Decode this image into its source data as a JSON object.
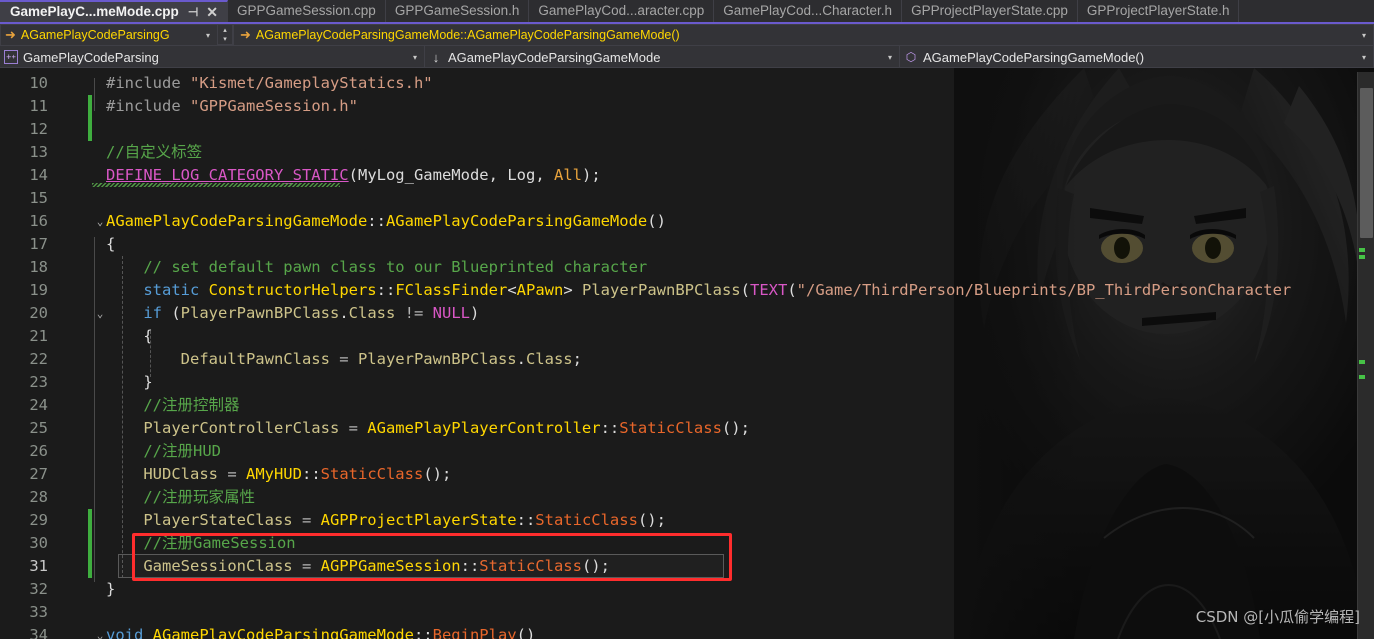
{
  "window": {
    "app": "Visual Studio Code Editor",
    "accent_color": "#6a5acd",
    "background_color": "#1b1b1b"
  },
  "tabs": [
    {
      "title": "GamePlayC...meMode.cpp",
      "active": true,
      "pin_icon": "pin-icon",
      "close_icon": "close-icon"
    },
    {
      "title": "GPPGameSession.cpp",
      "active": false
    },
    {
      "title": "GPPGameSession.h",
      "active": false
    },
    {
      "title": "GamePlayCod...aracter.cpp",
      "active": false
    },
    {
      "title": "GamePlayCod...Character.h",
      "active": false
    },
    {
      "title": "GPProjectPlayerState.cpp",
      "active": false
    },
    {
      "title": "GPProjectPlayerState.h",
      "active": false
    }
  ],
  "navbar1": {
    "left_combo": {
      "icon": "right-arrow-icon",
      "value": "AGamePlayCodeParsingG",
      "caret": "▾"
    },
    "spinner": {
      "up": "▴",
      "down": "▾"
    },
    "right_combo": {
      "icon": "right-arrow-icon",
      "value": "AGamePlayCodeParsingGameMode::AGamePlayCodeParsingGameMode()",
      "caret": "▾"
    }
  },
  "breadcrumb": {
    "project": {
      "icon": "project-icon",
      "label": "GamePlayCodeParsing",
      "caret": "▾"
    },
    "class": {
      "icon": "class-icon",
      "label": "AGamePlayCodeParsingGameMode",
      "caret": "▾"
    },
    "member": {
      "icon": "method-icon",
      "label": "AGamePlayCodeParsingGameMode()",
      "caret": "▾"
    }
  },
  "editor": {
    "first_line": 10,
    "current_line": 31,
    "lines": [
      {
        "num": "10",
        "tokens": [
          {
            "t": "#include ",
            "c": "t-pre"
          },
          {
            "t": "\"Kismet/GameplayStatics.h\"",
            "c": "t-str"
          }
        ]
      },
      {
        "num": "11",
        "tokens": [
          {
            "t": "#include ",
            "c": "t-pre"
          },
          {
            "t": "\"GPPGameSession.h\"",
            "c": "t-str"
          }
        ]
      },
      {
        "num": "12",
        "tokens": []
      },
      {
        "num": "13",
        "tokens": [
          {
            "t": "//自定义标签",
            "c": "t-cmt"
          }
        ]
      },
      {
        "num": "14",
        "tokens": [
          {
            "t": "DEFINE_LOG_CATEGORY_STATIC",
            "c": "t-macro"
          },
          {
            "t": "(",
            "c": "t-punct"
          },
          {
            "t": "MyLog_GameMode",
            "c": "t-plain"
          },
          {
            "t": ", ",
            "c": "t-punct"
          },
          {
            "t": "Log",
            "c": "t-plain"
          },
          {
            "t": ", ",
            "c": "t-punct"
          },
          {
            "t": "All",
            "c": "t-num"
          },
          {
            "t": ");",
            "c": "t-punct"
          }
        ]
      },
      {
        "num": "15",
        "tokens": []
      },
      {
        "num": "16",
        "tokens": [
          {
            "t": "AGamePlayCodeParsingGameMode",
            "c": "t-type"
          },
          {
            "t": "::",
            "c": "t-punct"
          },
          {
            "t": "AGamePlayCodeParsingGameMode",
            "c": "t-type"
          },
          {
            "t": "()",
            "c": "t-punct"
          }
        ]
      },
      {
        "num": "17",
        "tokens": [
          {
            "t": "{",
            "c": "t-punct"
          }
        ]
      },
      {
        "num": "18",
        "tokens": [
          {
            "t": "    // set default pawn class to our Blueprinted character",
            "c": "t-cmt"
          }
        ]
      },
      {
        "num": "19",
        "tokens": [
          {
            "t": "    ",
            "c": "t-plain"
          },
          {
            "t": "static",
            "c": "t-kw"
          },
          {
            "t": " ",
            "c": "t-plain"
          },
          {
            "t": "ConstructorHelpers",
            "c": "t-type"
          },
          {
            "t": "::",
            "c": "t-punct"
          },
          {
            "t": "FClassFinder",
            "c": "t-type"
          },
          {
            "t": "<",
            "c": "t-punct"
          },
          {
            "t": "APawn",
            "c": "t-type"
          },
          {
            "t": "> ",
            "c": "t-punct"
          },
          {
            "t": "PlayerPawnBPClass",
            "c": "t-var"
          },
          {
            "t": "(",
            "c": "t-punct"
          },
          {
            "t": "TEXT",
            "c": "t-kw2"
          },
          {
            "t": "(",
            "c": "t-punct"
          },
          {
            "t": "\"/Game/ThirdPerson/Blueprints/BP_ThirdPersonCharacter",
            "c": "t-str"
          }
        ]
      },
      {
        "num": "20",
        "tokens": [
          {
            "t": "    ",
            "c": "t-plain"
          },
          {
            "t": "if",
            "c": "t-kw"
          },
          {
            "t": " (",
            "c": "t-punct"
          },
          {
            "t": "PlayerPawnBPClass",
            "c": "t-var"
          },
          {
            "t": ".",
            "c": "t-punct"
          },
          {
            "t": "Class",
            "c": "t-var"
          },
          {
            "t": " != ",
            "c": "t-op"
          },
          {
            "t": "NULL",
            "c": "t-kw2"
          },
          {
            "t": ")",
            "c": "t-punct"
          }
        ]
      },
      {
        "num": "21",
        "tokens": [
          {
            "t": "    {",
            "c": "t-punct"
          }
        ]
      },
      {
        "num": "22",
        "tokens": [
          {
            "t": "        ",
            "c": "t-plain"
          },
          {
            "t": "DefaultPawnClass",
            "c": "t-var"
          },
          {
            "t": " = ",
            "c": "t-op"
          },
          {
            "t": "PlayerPawnBPClass",
            "c": "t-var"
          },
          {
            "t": ".",
            "c": "t-punct"
          },
          {
            "t": "Class",
            "c": "t-var"
          },
          {
            "t": ";",
            "c": "t-punct"
          }
        ]
      },
      {
        "num": "23",
        "tokens": [
          {
            "t": "    }",
            "c": "t-punct"
          }
        ]
      },
      {
        "num": "24",
        "tokens": [
          {
            "t": "    //注册控制器",
            "c": "t-cmt"
          }
        ]
      },
      {
        "num": "25",
        "tokens": [
          {
            "t": "    ",
            "c": "t-plain"
          },
          {
            "t": "PlayerControllerClass",
            "c": "t-var"
          },
          {
            "t": " = ",
            "c": "t-op"
          },
          {
            "t": "AGamePlayPlayerController",
            "c": "t-type"
          },
          {
            "t": "::",
            "c": "t-punct"
          },
          {
            "t": "StaticClass",
            "c": "t-fn"
          },
          {
            "t": "();",
            "c": "t-punct"
          }
        ]
      },
      {
        "num": "26",
        "tokens": [
          {
            "t": "    //注册HUD",
            "c": "t-cmt"
          }
        ]
      },
      {
        "num": "27",
        "tokens": [
          {
            "t": "    ",
            "c": "t-plain"
          },
          {
            "t": "HUDClass",
            "c": "t-var"
          },
          {
            "t": " = ",
            "c": "t-op"
          },
          {
            "t": "AMyHUD",
            "c": "t-type"
          },
          {
            "t": "::",
            "c": "t-punct"
          },
          {
            "t": "StaticClass",
            "c": "t-fn"
          },
          {
            "t": "();",
            "c": "t-punct"
          }
        ]
      },
      {
        "num": "28",
        "tokens": [
          {
            "t": "    //注册玩家属性",
            "c": "t-cmt"
          }
        ]
      },
      {
        "num": "29",
        "tokens": [
          {
            "t": "    ",
            "c": "t-plain"
          },
          {
            "t": "PlayerStateClass",
            "c": "t-var"
          },
          {
            "t": " = ",
            "c": "t-op"
          },
          {
            "t": "AGPProjectPlayerState",
            "c": "t-type"
          },
          {
            "t": "::",
            "c": "t-punct"
          },
          {
            "t": "StaticClass",
            "c": "t-fn"
          },
          {
            "t": "();",
            "c": "t-punct"
          }
        ]
      },
      {
        "num": "30",
        "tokens": [
          {
            "t": "    //注册GameSession",
            "c": "t-cmt"
          }
        ]
      },
      {
        "num": "31",
        "tokens": [
          {
            "t": "    ",
            "c": "t-plain"
          },
          {
            "t": "GameSessionClass",
            "c": "t-var"
          },
          {
            "t": " = ",
            "c": "t-op"
          },
          {
            "t": "AGPPGameSession",
            "c": "t-type"
          },
          {
            "t": "::",
            "c": "t-punct"
          },
          {
            "t": "StaticClass",
            "c": "t-fn"
          },
          {
            "t": "();",
            "c": "t-punct"
          }
        ]
      },
      {
        "num": "32",
        "tokens": [
          {
            "t": "}",
            "c": "t-punct"
          }
        ]
      },
      {
        "num": "33",
        "tokens": []
      },
      {
        "num": "34",
        "tokens": [
          {
            "t": "void",
            "c": "t-kw"
          },
          {
            "t": " ",
            "c": "t-plain"
          },
          {
            "t": "AGamePlayCodeParsingGameMode",
            "c": "t-type"
          },
          {
            "t": "::",
            "c": "t-punct"
          },
          {
            "t": "BeginPlay",
            "c": "t-fn"
          },
          {
            "t": "()",
            "c": "t-punct"
          }
        ]
      }
    ],
    "fold_markers": [
      {
        "line": "16",
        "glyph": "⌄"
      },
      {
        "line": "20",
        "glyph": "⌄"
      },
      {
        "line": "34",
        "glyph": "⌄"
      }
    ]
  },
  "annotation": {
    "type": "red-rectangle-highlight",
    "color": "#ff2d2d",
    "covers_lines": [
      "30",
      "31"
    ]
  },
  "scrollbar": {
    "thumb_color": "#5c5c5c",
    "marker_color": "#46c246"
  },
  "watermark": {
    "text": "CSDN @[小瓜偷学编程]"
  }
}
